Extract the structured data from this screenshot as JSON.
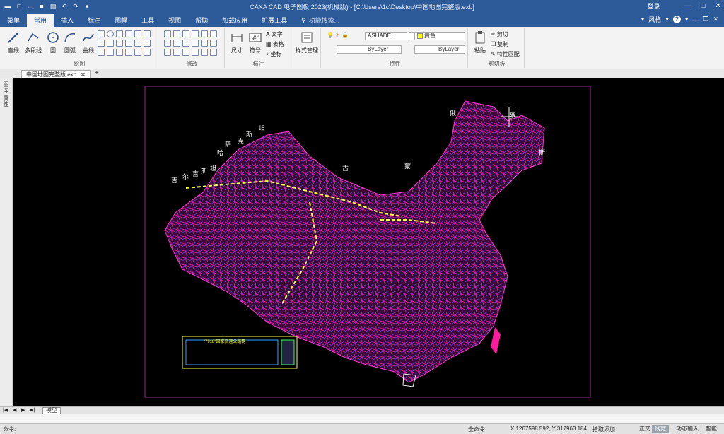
{
  "window": {
    "title": "CAXA CAD 电子图板 2023(机械版) - [C:\\Users\\1c\\Desktop\\中国地图完整版.exb]",
    "login": "登录"
  },
  "menu": {
    "tabs": [
      "菜单",
      "常用",
      "插入",
      "标注",
      "图幅",
      "工具",
      "视图",
      "帮助",
      "加载应用",
      "扩展工具"
    ],
    "active": "常用",
    "search_placeholder": "功能搜索...",
    "style_label": "风格"
  },
  "ribbon": {
    "draw": {
      "buttons": [
        "直线",
        "多段线",
        "圆",
        "圆弧",
        "曲线"
      ],
      "label": "绘图"
    },
    "modify": {
      "label": "修改"
    },
    "annotate": {
      "buttons": [
        "尺寸",
        "符号"
      ],
      "text_buttons": [
        "文字",
        "表格",
        "坐标"
      ],
      "style_manager": "样式管理",
      "label": "标注"
    },
    "properties": {
      "layer": "ASHADE",
      "color": "黄色",
      "linetype1": "ByLayer",
      "linetype2": "ByLayer",
      "label": "特性"
    },
    "clipboard": {
      "paste": "粘贴",
      "items": [
        "剪切",
        "复制",
        "特性匹配"
      ],
      "label": "剪切板"
    }
  },
  "document": {
    "tab": "中国地图完整版.exb",
    "add_tab": "+"
  },
  "left_toolbar": {
    "labels": [
      "图库",
      "属性"
    ]
  },
  "map": {
    "labels": [
      "俄",
      "罗",
      "斯",
      "哈",
      "萨",
      "克",
      "斯",
      "坦",
      "吉",
      "尔",
      "吉",
      "斯",
      "坦",
      "古",
      "蒙",
      "斯"
    ],
    "legend_title": "“7918”国家高速公路网"
  },
  "bottom": {
    "nav": [
      "|◀",
      "◀",
      "▶",
      "▶|"
    ],
    "model_tab": "模型"
  },
  "status": {
    "command": "命令:",
    "all_commands": "全命令",
    "coords": "X:1267598.592, Y:317963.184",
    "pick": "拾取添加",
    "switches": [
      "正交",
      "线宽",
      "动态输入",
      "智能"
    ],
    "active_switch": "线宽"
  },
  "colors": {
    "title_bg": "#2d5b9a",
    "canvas_bg": "#000000",
    "frame": "#a020a0",
    "border_line": "#ffff44"
  }
}
